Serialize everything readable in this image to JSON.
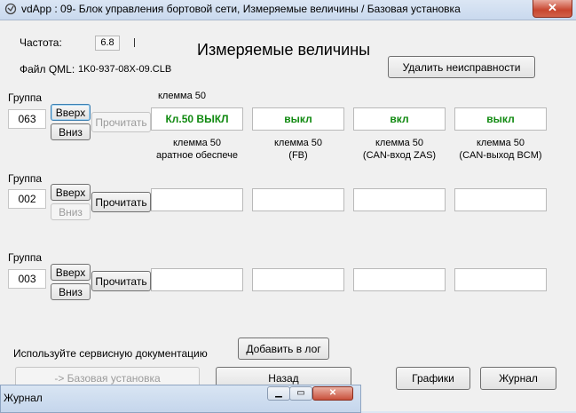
{
  "window": {
    "title": "vdApp : 09- Блок управления бортовой сети,  Измеряемые величины / Базовая установка",
    "close_glyph": "✕"
  },
  "header": {
    "freq_label": "Частота:",
    "freq_value": "6.8",
    "file_label": "Файл QML:",
    "file_value": "1K0-937-08X-09.CLB",
    "title": "Измеряемые величины",
    "delete_faults_label": "Удалить неисправности"
  },
  "labels": {
    "group": "Группа",
    "up": "Вверх",
    "down": "Вниз",
    "read": "Прочитать"
  },
  "groups": [
    {
      "number": "063",
      "heading": "клемма 50",
      "values": [
        "Кл.50 ВЫКЛ",
        "выкл",
        "вкл",
        "выкл"
      ],
      "captions": [
        [
          "клемма 50",
          "аратное обеспече"
        ],
        [
          "клемма 50",
          "(FB)"
        ],
        [
          "клемма 50",
          "(CAN-вход ZAS)"
        ],
        [
          "клемма 50",
          "(CAN-выход BCM)"
        ]
      ]
    },
    {
      "number": "002",
      "heading": "",
      "values": [
        "",
        "",
        "",
        ""
      ]
    },
    {
      "number": "003",
      "heading": "",
      "values": [
        "",
        "",
        "",
        ""
      ]
    }
  ],
  "footer": {
    "service_doc_text": "Используйте сервисную документацию",
    "add_log_label": "Добавить в лог",
    "basic_setting_label": "-> Базовая установка",
    "back_label": "Назад",
    "graphs_label": "Графики",
    "journal_label": "Журнал"
  },
  "journal_window": {
    "title": "Журнал",
    "minimize_glyph": "▁",
    "maximize_glyph": "▭",
    "close_glyph": "✕"
  },
  "colors": {
    "value_text": "#118a11",
    "window_bg": "#f0f0f0",
    "titlebar": "#c9d9ee",
    "close_red": "#c7462f"
  }
}
